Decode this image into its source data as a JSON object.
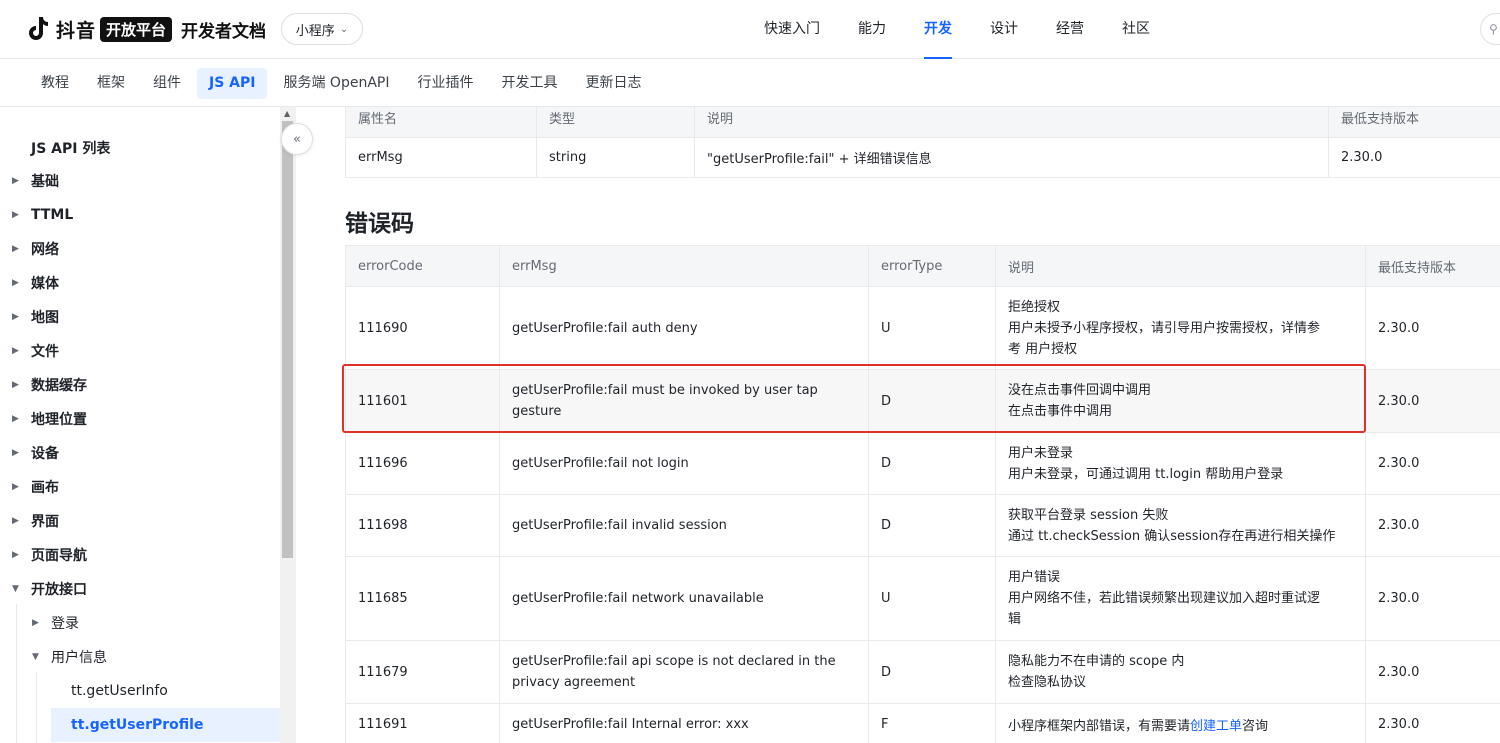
{
  "header": {
    "brand": "抖音",
    "badge": "开放平台",
    "docs": "开发者文档",
    "product": "小程序",
    "nav": [
      {
        "label": "快速入门"
      },
      {
        "label": "能力"
      },
      {
        "label": "开发",
        "active": true
      },
      {
        "label": "设计"
      },
      {
        "label": "经营"
      },
      {
        "label": "社区"
      }
    ]
  },
  "subnav": [
    {
      "label": "教程"
    },
    {
      "label": "框架"
    },
    {
      "label": "组件"
    },
    {
      "label": "JS API",
      "active": true
    },
    {
      "label": "服务端 OpenAPI"
    },
    {
      "label": "行业插件"
    },
    {
      "label": "开发工具"
    },
    {
      "label": "更新日志"
    }
  ],
  "sidebar": {
    "title": "JS API 列表",
    "items": [
      {
        "label": "基础"
      },
      {
        "label": "TTML"
      },
      {
        "label": "网络"
      },
      {
        "label": "媒体"
      },
      {
        "label": "地图"
      },
      {
        "label": "文件"
      },
      {
        "label": "数据缓存"
      },
      {
        "label": "地理位置"
      },
      {
        "label": "设备"
      },
      {
        "label": "画布"
      },
      {
        "label": "界面"
      },
      {
        "label": "页面导航"
      },
      {
        "label": "开放接口"
      }
    ],
    "sub_items": [
      {
        "label": "登录"
      },
      {
        "label": "用户信息"
      }
    ],
    "leaf_items": [
      {
        "label": "tt.getUserInfo"
      },
      {
        "label": "tt.getUserProfile",
        "active": true
      }
    ]
  },
  "attr_table": {
    "headers": [
      "属性名",
      "类型",
      "说明",
      "最低支持版本"
    ],
    "rows": [
      [
        "errMsg",
        "string",
        "\"getUserProfile:fail\" + 详细错误信息",
        "2.30.0"
      ]
    ]
  },
  "error_section": {
    "title": "错误码",
    "headers": [
      "errorCode",
      "errMsg",
      "errorType",
      "说明",
      "最低支持版本"
    ],
    "rows": [
      {
        "code": "111690",
        "msg": [
          "getUserProfile:fail auth deny"
        ],
        "type": "U",
        "desc": [
          "拒绝授权",
          "用户未授予小程序授权，请引导用户按需授权，详情参",
          "考 用户授权"
        ],
        "ver": "2.30.0"
      },
      {
        "code": "111601",
        "msg": [
          "getUserProfile:fail must be invoked by user tap gesture"
        ],
        "type": "D",
        "desc": [
          "没在点击事件回调中调用",
          "在点击事件中调用"
        ],
        "ver": "2.30.0"
      },
      {
        "code": "111696",
        "msg": [
          "getUserProfile:fail not login"
        ],
        "type": "D",
        "desc": [
          "用户未登录",
          "用户未登录，可通过调用 tt.login 帮助用户登录"
        ],
        "ver": "2.30.0"
      },
      {
        "code": "111698",
        "msg": [
          "getUserProfile:fail invalid session"
        ],
        "type": "D",
        "desc": [
          "获取平台登录 session 失败",
          "通过 tt.checkSession 确认session存在再进行相关操作"
        ],
        "ver": "2.30.0"
      },
      {
        "code": "111685",
        "msg": [
          "getUserProfile:fail network unavailable"
        ],
        "type": "U",
        "desc": [
          "用户错误",
          "用户网络不佳，若此错误频繁出现建议加入超时重试逻",
          "辑"
        ],
        "ver": "2.30.0"
      },
      {
        "code": "111679",
        "msg": [
          "getUserProfile:fail api scope is not declared in the",
          "privacy agreement"
        ],
        "type": "D",
        "desc": [
          "隐私能力不在申请的 scope 内",
          "检查隐私协议"
        ],
        "ver": "2.30.0"
      },
      {
        "code": "111691",
        "msg": [
          "getUserProfile:fail Internal error: xxx"
        ],
        "type": "F",
        "desc_pre": "小程序框架内部错误，有需要请",
        "desc_link": "创建工单",
        "desc_post": "咨询",
        "ver": "2.30.0"
      }
    ]
  },
  "colors": {
    "accent": "#1664ff",
    "highlight": "#e0312b"
  }
}
